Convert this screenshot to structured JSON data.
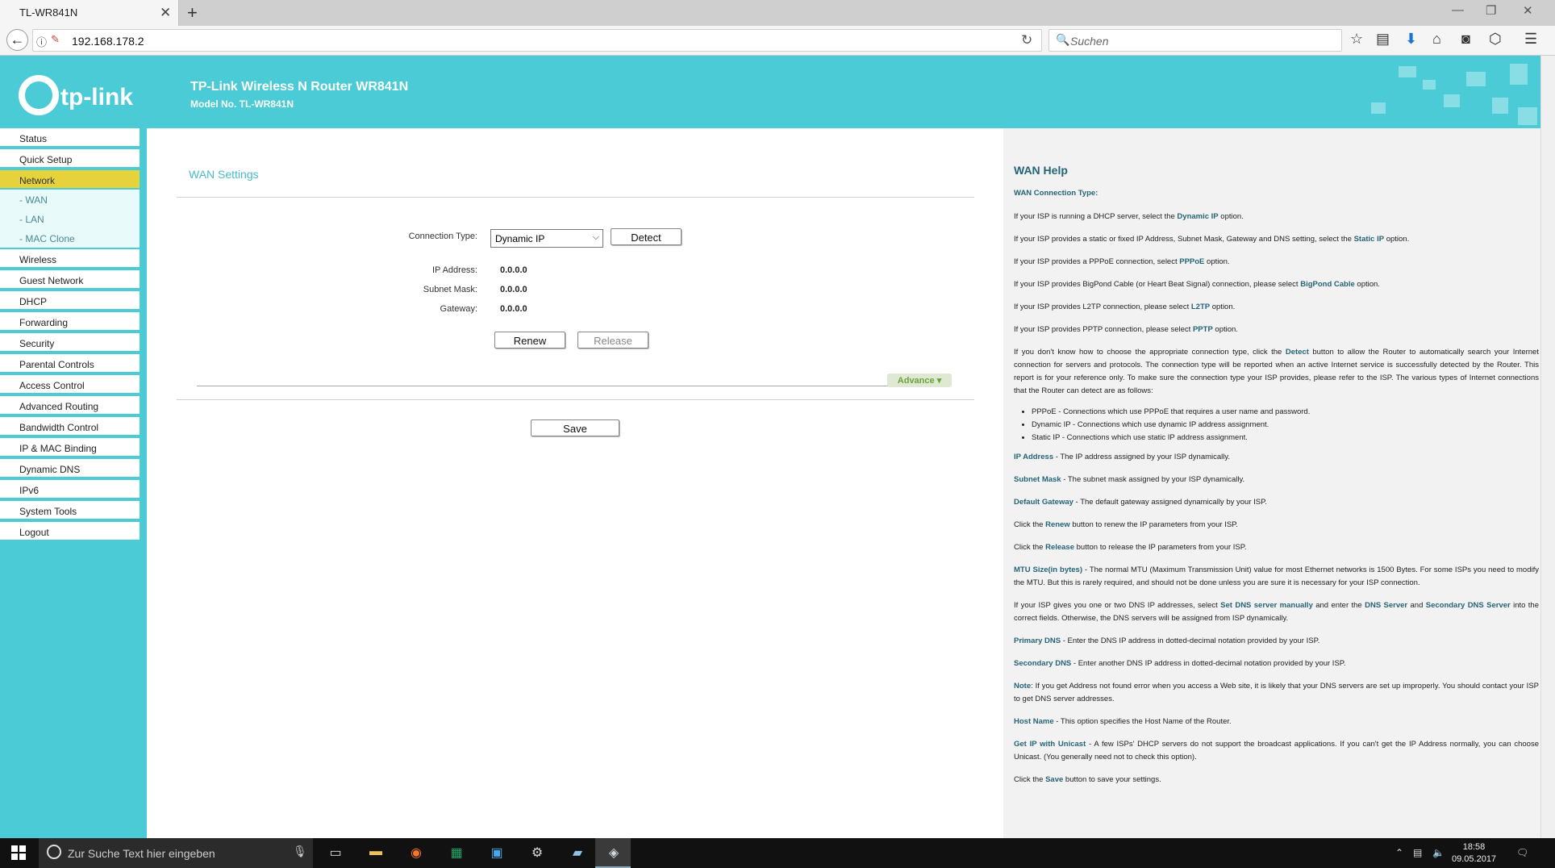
{
  "browser": {
    "tab_title": "TL-WR841N",
    "tab_close": "✕",
    "new_tab": "+",
    "url": "192.168.178.2",
    "search_placeholder": "Suchen",
    "icons": [
      "back-icon",
      "info-icon",
      "insecure-icon",
      "reload-icon",
      "search-icon",
      "star-icon",
      "reader-icon",
      "download-icon",
      "home-icon",
      "pocket-icon",
      "shield-icon",
      "menu-icon"
    ]
  },
  "header": {
    "logo_text": "tp-link",
    "title": "TP-Link Wireless N Router WR841N",
    "model": "Model No. TL-WR841N"
  },
  "menu": {
    "items": [
      {
        "label": "Status"
      },
      {
        "label": "Quick Setup"
      },
      {
        "label": "Network"
      },
      {
        "label": "- WAN"
      },
      {
        "label": "- LAN"
      },
      {
        "label": "- MAC Clone"
      },
      {
        "label": "Wireless"
      },
      {
        "label": "Guest Network"
      },
      {
        "label": "DHCP"
      },
      {
        "label": "Forwarding"
      },
      {
        "label": "Security"
      },
      {
        "label": "Parental Controls"
      },
      {
        "label": "Access Control"
      },
      {
        "label": "Advanced Routing"
      },
      {
        "label": "Bandwidth Control"
      },
      {
        "label": "IP & MAC Binding"
      },
      {
        "label": "Dynamic DNS"
      },
      {
        "label": "IPv6"
      },
      {
        "label": "System Tools"
      },
      {
        "label": "Logout"
      }
    ],
    "active": "Network"
  },
  "wan": {
    "title": "WAN Settings",
    "connection_type_label": "Connection Type:",
    "connection_type_value": "Dynamic IP",
    "detect_label": "Detect",
    "ip_label": "IP Address:",
    "ip_value": "0.0.0.0",
    "mask_label": "Subnet Mask:",
    "mask_value": "0.0.0.0",
    "gateway_label": "Gateway:",
    "gateway_value": "0.0.0.0",
    "renew_label": "Renew",
    "release_label": "Release",
    "advance_label": "Advance",
    "save_label": "Save"
  },
  "help": {
    "title": "WAN Help",
    "conn_type_heading": "WAN Connection Type:",
    "p1_a": "If your ISP is running a DHCP server, select the ",
    "p1_k": "Dynamic IP",
    "p1_b": " option.",
    "p2_a": "If your ISP provides a static or fixed IP Address, Subnet Mask, Gateway and DNS setting, select the ",
    "p2_k": "Static IP",
    "p2_b": " option.",
    "p3_a": "If your ISP provides a PPPoE connection, select ",
    "p3_k": "PPPoE",
    "p3_b": " option.",
    "p4_a": "If your ISP provides BigPond Cable (or Heart Beat Signal) connection, please select ",
    "p4_k": "BigPond Cable",
    "p4_b": " option.",
    "p5_a": "If your ISP provides L2TP connection, please select ",
    "p5_k": "L2TP",
    "p5_b": " option.",
    "p6_a": "If your ISP provides PPTP connection, please select ",
    "p6_k": "PPTP",
    "p6_b": " option.",
    "p7_a": "If you don't know how to choose the appropriate connection type, click the ",
    "p7_k": "Detect",
    "p7_b": " button to allow the Router to automatically search your Internet connection for servers and protocols. The connection type will be reported when an active Internet service is successfully detected by the Router. This report is for your reference only. To make sure the connection type your ISP provides, please refer to the ISP. The various types of Internet connections that the Router can detect are as follows:",
    "li1": "PPPoE - Connections which use PPPoE that requires a user name and password.",
    "li2": "Dynamic IP - Connections which use dynamic IP address assignment.",
    "li3": "Static IP - Connections which use static IP address assignment.",
    "p8_k": "IP Address",
    "p8_b": " - The IP address assigned by your ISP dynamically.",
    "p9_k": "Subnet Mask",
    "p9_b": " - The subnet mask assigned by your ISP dynamically.",
    "p10_k": "Default Gateway",
    "p10_b": " - The default gateway assigned dynamically by your ISP.",
    "p11_a": "Click the ",
    "p11_k": "Renew",
    "p11_b": " button to renew the IP parameters from your ISP.",
    "p12_a": "Click the ",
    "p12_k": "Release",
    "p12_b": " button to release the IP parameters from your ISP.",
    "p13_k": "MTU Size(in bytes)",
    "p13_b": " - The normal MTU (Maximum Transmission Unit) value for most Ethernet networks is 1500 Bytes. For some ISPs you need to modify the MTU. But this is rarely required, and should not be done unless you are sure it is necessary for your ISP connection.",
    "p14_a": "If your ISP gives you one or two DNS IP addresses, select ",
    "p14_k1": "Set DNS server manually",
    "p14_b": " and enter the ",
    "p14_k2": "DNS Server",
    "p14_c": " and ",
    "p14_k3": "Secondary DNS Server",
    "p14_d": " into the correct fields. Otherwise, the DNS servers will be assigned from ISP dynamically.",
    "p15_k": "Primary DNS",
    "p15_b": " - Enter the DNS IP address in dotted-decimal notation provided by your ISP.",
    "p16_k": "Secondary DNS",
    "p16_b": " - Enter another DNS IP address in dotted-decimal notation provided by your ISP.",
    "p17_k": "Note",
    "p17_b": ": If you get Address not found error when you access a Web site, it is likely that your DNS servers are set up improperly. You should contact your ISP to get DNS server addresses.",
    "p18_k": "Host Name",
    "p18_b": " - This option specifies the Host Name of the Router.",
    "p19_k": "Get IP with Unicast",
    "p19_b": " - A few ISPs' DHCP servers do not support the broadcast applications. If you can't get the IP Address normally, you can choose Unicast. (You generally need not to check this option).",
    "p20_a": "Click the ",
    "p20_k": "Save",
    "p20_b": " button to save your settings."
  },
  "taskbar": {
    "search_placeholder": "Zur Suche Text hier eingeben",
    "time": "18:58",
    "date": "09.05.2017"
  }
}
